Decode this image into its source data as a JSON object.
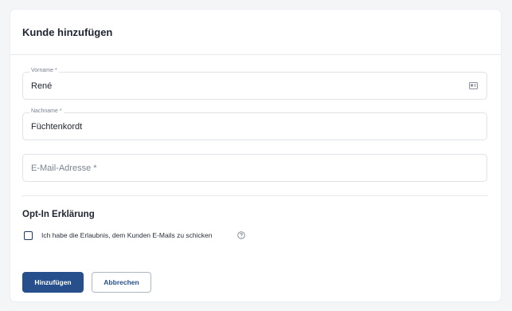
{
  "dialog": {
    "title": "Kunde hinzufügen"
  },
  "form": {
    "first_name": {
      "label": "Vorname *",
      "value": "René"
    },
    "last_name": {
      "label": "Nachname *",
      "value": "Füchtenkordt"
    },
    "email": {
      "placeholder": "E-Mail-Adresse *",
      "value": ""
    }
  },
  "opt_in": {
    "title": "Opt-In Erklärung",
    "checkbox_label": "Ich habe die Erlaubnis, dem Kunden E-Mails zu schicken",
    "checked": false
  },
  "actions": {
    "submit_label": "Hinzufügen",
    "cancel_label": "Abbrechen"
  },
  "icons": {
    "first_name_field": "id-card-icon",
    "opt_in_help": "help-circle-icon"
  },
  "colors": {
    "primary": "#264f8c",
    "border": "#dfe2e7",
    "background": "#f4f5f7"
  }
}
